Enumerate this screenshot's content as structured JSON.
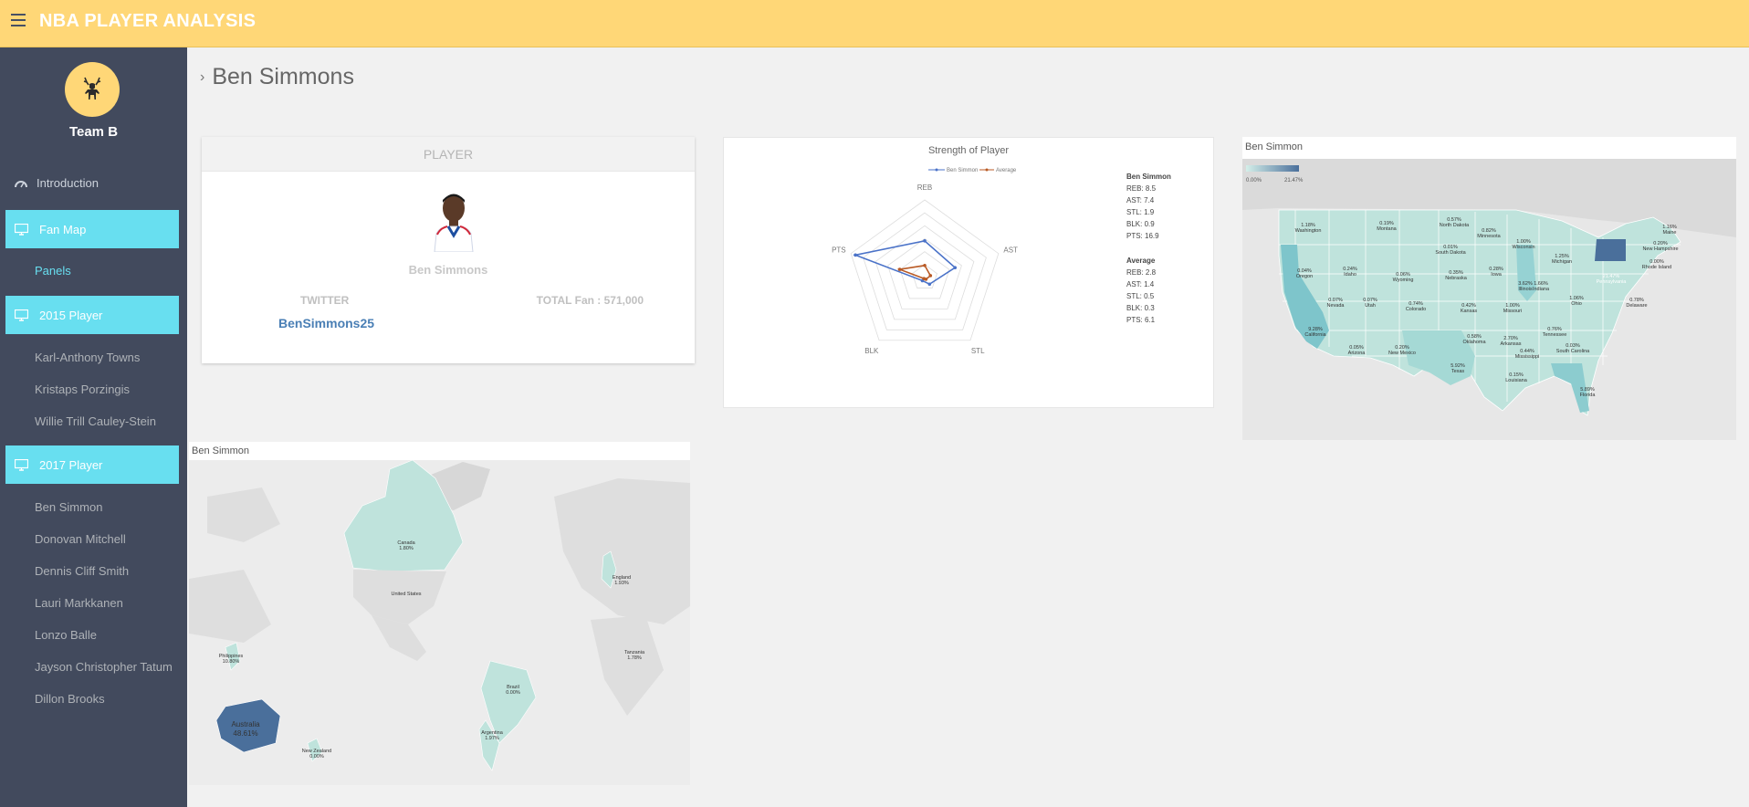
{
  "header": {
    "title": "NBA PLAYER ANALYSIS",
    "menu_icon": "hamburger-icon"
  },
  "sidebar": {
    "team_name": "Team B",
    "logo_icon": "deer-icon",
    "intro_label": "Introduction",
    "fan_map_label": "Fan Map",
    "panels_label": "Panels",
    "player_2015_label": "2015 Player",
    "players_2015": [
      "Karl-Anthony Towns",
      "Kristaps Porzingis",
      "Willie Trill Cauley-Stein"
    ],
    "player_2017_label": "2017 Player",
    "players_2017": [
      "Ben Simmon",
      "Donovan Mitchell",
      "Dennis Cliff Smith",
      "Lauri Markkanen",
      "Lonzo Balle",
      "Jayson Christopher Tatum",
      "Dillon Brooks"
    ]
  },
  "page": {
    "title": "Ben Simmons"
  },
  "player_card": {
    "header": "PLAYER",
    "name": "Ben Simmons",
    "twitter_label": "TWITTER",
    "twitter_handle": "BenSimmons25",
    "total_fan": "TOTAL Fan : 571,000"
  },
  "radar": {
    "title": "Strength of Player",
    "legend": [
      "Ben Simmon",
      "Average"
    ],
    "axes": [
      "REB",
      "AST",
      "STL",
      "BLK",
      "PTS"
    ],
    "player_name": "Ben Simmon",
    "player_values": [
      8.5,
      7.4,
      1.9,
      0.9,
      16.9
    ],
    "average_name": "Average",
    "average_values": [
      2.8,
      1.4,
      0.5,
      0.3,
      6.1
    ],
    "player_color": "#4a72c8",
    "average_color": "#b95a25"
  },
  "us_map": {
    "caption": "Ben Simmon",
    "legend_min": "0.00%",
    "legend_max": "21.47%",
    "labels": [
      {
        "name": "Washington",
        "value": "1.18%"
      },
      {
        "name": "Oregon",
        "value": "0.04%"
      },
      {
        "name": "California",
        "value": "9.28%"
      },
      {
        "name": "Nevada",
        "value": "0.07%"
      },
      {
        "name": "Idaho",
        "value": "0.24%"
      },
      {
        "name": "Utah",
        "value": "0.07%"
      },
      {
        "name": "Arizona",
        "value": "0.05%"
      },
      {
        "name": "Montana",
        "value": "0.19%"
      },
      {
        "name": "Wyoming",
        "value": "0.06%"
      },
      {
        "name": "Colorado",
        "value": "0.74%"
      },
      {
        "name": "New Mexico",
        "value": "0.20%"
      },
      {
        "name": "North Dakota",
        "value": "0.57%"
      },
      {
        "name": "South Dakota",
        "value": "0.01%"
      },
      {
        "name": "Nebraska",
        "value": "0.35%"
      },
      {
        "name": "Kansas",
        "value": "0.42%"
      },
      {
        "name": "Oklahoma",
        "value": "0.58%"
      },
      {
        "name": "Texas",
        "value": "5.92%"
      },
      {
        "name": "Minnesota",
        "value": "0.82%"
      },
      {
        "name": "Iowa",
        "value": "0.28%"
      },
      {
        "name": "Missouri",
        "value": "1.00%"
      },
      {
        "name": "Arkansas",
        "value": "2.70%"
      },
      {
        "name": "Louisiana",
        "value": "0.15%"
      },
      {
        "name": "Wisconsin",
        "value": "1.00%"
      },
      {
        "name": "Illinois",
        "value": "3.62%"
      },
      {
        "name": "Indiana",
        "value": "1.66%"
      },
      {
        "name": "Mississippi",
        "value": "0.44%"
      },
      {
        "name": "Tennessee",
        "value": "0.76%"
      },
      {
        "name": "Michigan",
        "value": "1.25%"
      },
      {
        "name": "Ohio",
        "value": "1.06%"
      },
      {
        "name": "Pennsylvania",
        "value": "21.47%"
      },
      {
        "name": "New Hampshire",
        "value": "0.20%"
      },
      {
        "name": "Maine",
        "value": "1.16%"
      },
      {
        "name": "Rhode Island",
        "value": "0.00%"
      },
      {
        "name": "Delaware",
        "value": "0.78%"
      },
      {
        "name": "South Carolina",
        "value": "0.03%"
      },
      {
        "name": "Florida",
        "value": "5.89%"
      }
    ]
  },
  "world_map": {
    "caption": "Ben Simmon",
    "labels": [
      {
        "name": "Canada",
        "value": "1.80%"
      },
      {
        "name": "United States",
        "value": ""
      },
      {
        "name": "England",
        "value": "1.93%"
      },
      {
        "name": "Philippines",
        "value": "10.80%"
      },
      {
        "name": "Australia",
        "value": "48.61%"
      },
      {
        "name": "New Zealand",
        "value": "0.00%"
      },
      {
        "name": "Brazil",
        "value": "0.00%"
      },
      {
        "name": "Argentina",
        "value": "1.97%"
      },
      {
        "name": "Tanzania",
        "value": "1.78%"
      }
    ]
  }
}
